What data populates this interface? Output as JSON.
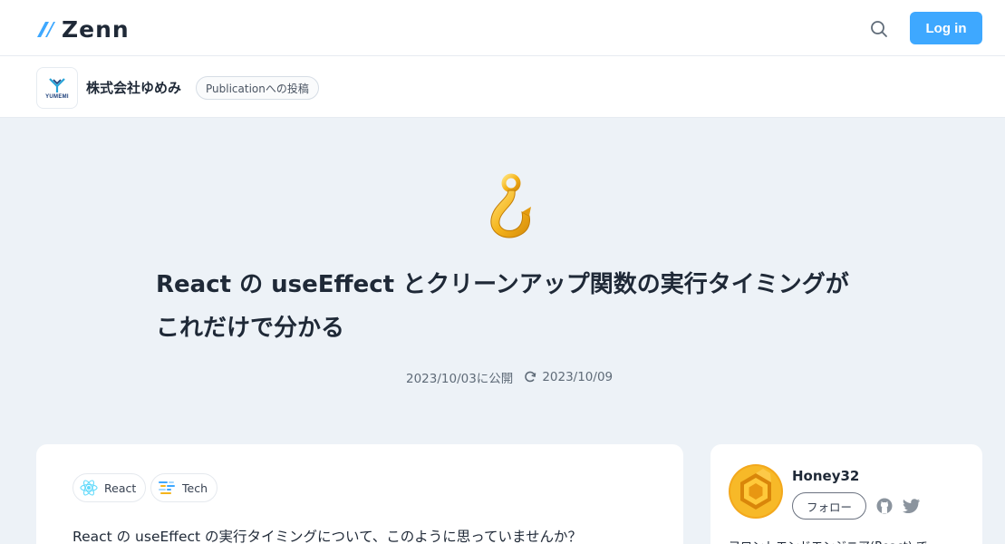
{
  "header": {
    "logo_text": "Zenn",
    "login_label": "Log in"
  },
  "publication": {
    "logo_text": "YUMEMI",
    "name": "株式会社ゆめみ",
    "badge": "Publicationへの投稿"
  },
  "article": {
    "emoji": "hook",
    "title": "React の useEffect とクリーンアップ関数の実行タイミングがこれだけで分かる",
    "published": "2023/10/03に公開",
    "updated": "2023/10/09",
    "topics": [
      {
        "label": "React",
        "icon": "react-icon"
      },
      {
        "label": "Tech",
        "icon": "tech-icon"
      }
    ],
    "intro": "React の useEffect の実行タイミングについて、このように思っていませんか？"
  },
  "author": {
    "name": "Honey32",
    "follow_label": "フォロー",
    "bio": "フロントエンドエンジニア(React) で"
  },
  "colors": {
    "accent": "#3ea8ff",
    "background": "#edf2f7",
    "text": "#1f2937"
  }
}
